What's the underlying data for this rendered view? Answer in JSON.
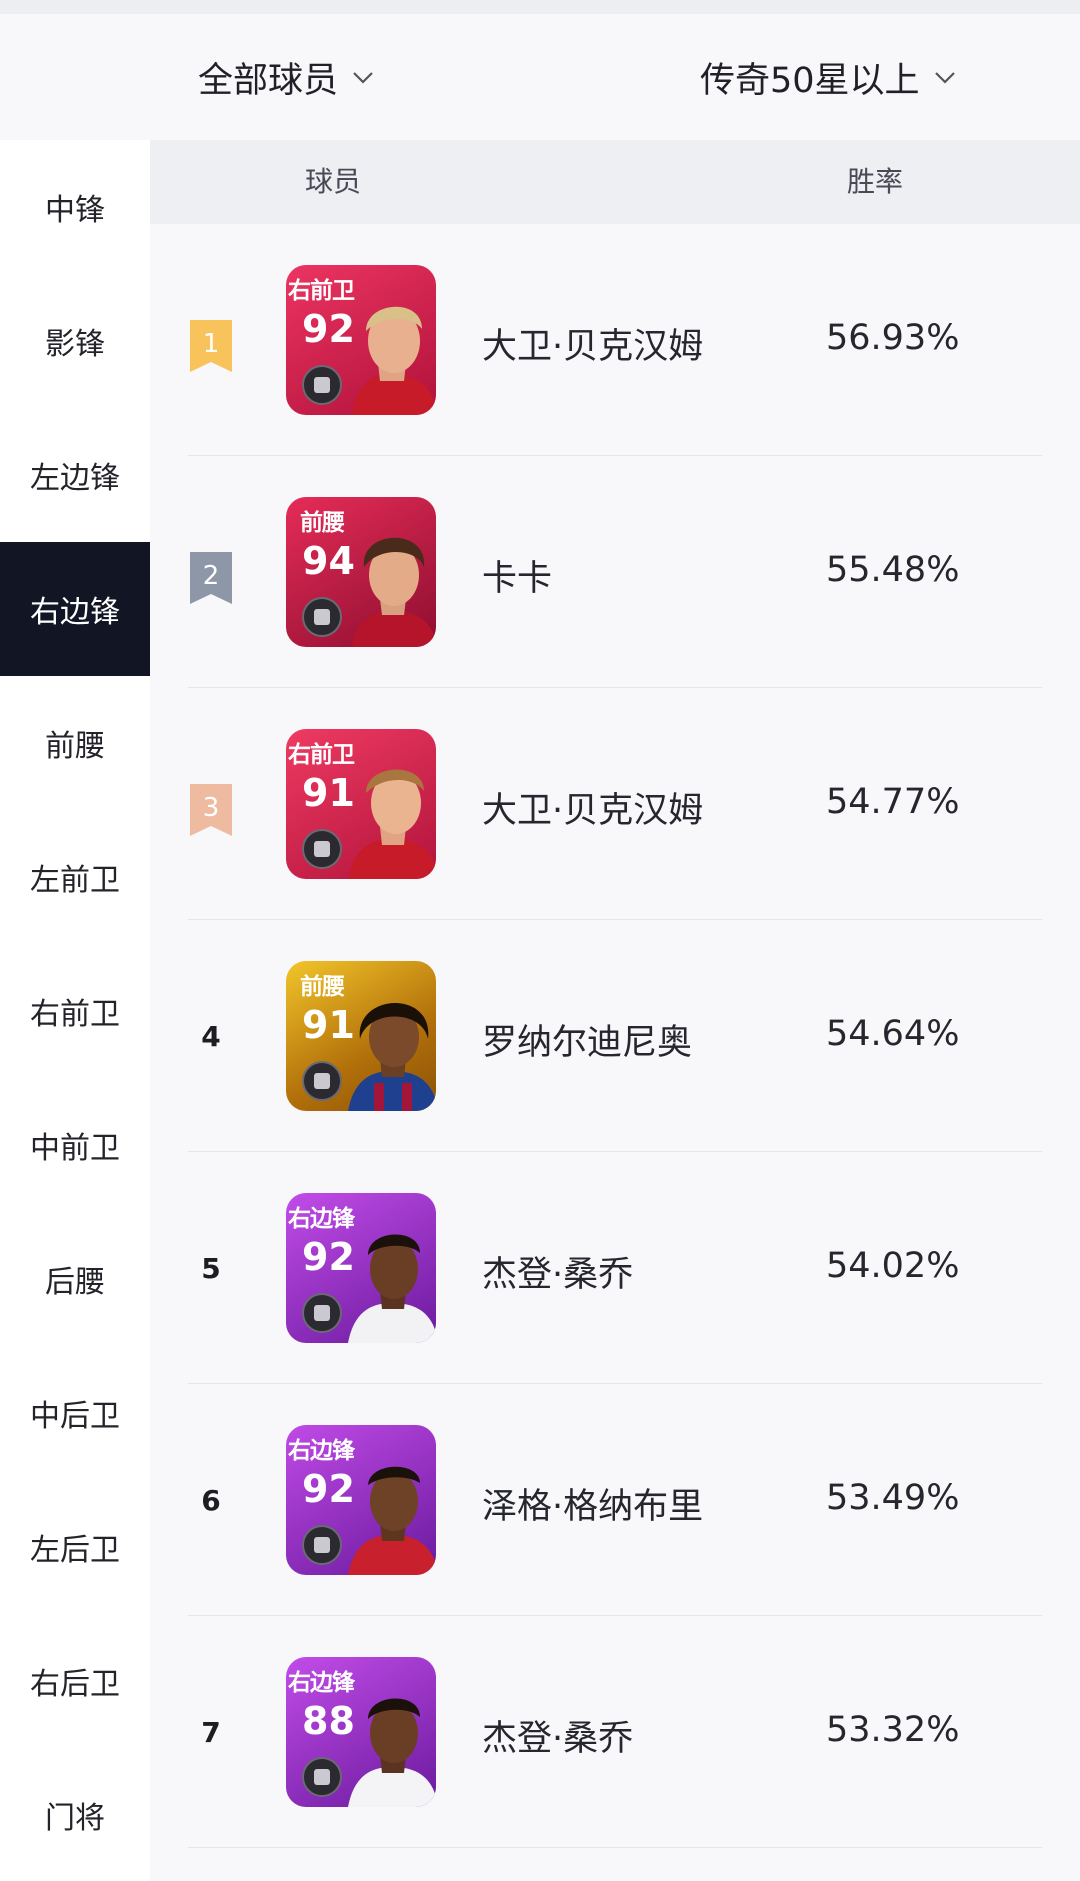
{
  "filters": {
    "player_filter": "全部球员",
    "rank_filter": "传奇50星以上"
  },
  "sidebar": {
    "items": [
      {
        "label": "中锋"
      },
      {
        "label": "影锋"
      },
      {
        "label": "左边锋"
      },
      {
        "label": "右边锋",
        "active": true
      },
      {
        "label": "前腰"
      },
      {
        "label": "左前卫"
      },
      {
        "label": "右前卫"
      },
      {
        "label": "中前卫"
      },
      {
        "label": "后腰"
      },
      {
        "label": "中后卫"
      },
      {
        "label": "左后卫"
      },
      {
        "label": "右后卫"
      },
      {
        "label": "门将"
      }
    ]
  },
  "table": {
    "header_player": "球员",
    "header_rate": "胜率",
    "rows": [
      {
        "rank": "1",
        "position": "右前卫",
        "rating": "92",
        "name": "大卫·贝克汉姆",
        "rate": "56.93%"
      },
      {
        "rank": "2",
        "position": "前腰",
        "rating": "94",
        "name": "卡卡",
        "rate": "55.48%"
      },
      {
        "rank": "3",
        "position": "右前卫",
        "rating": "91",
        "name": "大卫·贝克汉姆",
        "rate": "54.77%"
      },
      {
        "rank": "4",
        "position": "前腰",
        "rating": "91",
        "name": "罗纳尔迪尼奥",
        "rate": "54.64%"
      },
      {
        "rank": "5",
        "position": "右边锋",
        "rating": "92",
        "name": "杰登·桑乔",
        "rate": "54.02%"
      },
      {
        "rank": "6",
        "position": "右边锋",
        "rating": "92",
        "name": "泽格·格纳布里",
        "rate": "53.49%"
      },
      {
        "rank": "7",
        "position": "右边锋",
        "rating": "88",
        "name": "杰登·桑乔",
        "rate": "53.32%"
      }
    ]
  },
  "colors": {
    "sidebar_active_bg": "#121624",
    "rank1_flag": "#f7c35a",
    "rank2_flag": "#8e97a8",
    "rank3_flag": "#efbba0",
    "card_red": "#d8254e",
    "card_gold": "#c8860e",
    "card_purple": "#9a35c9"
  },
  "icons": {
    "dropdown": "chevron-down-icon",
    "rank_flag": "rank-ribbon-icon",
    "card_badge": "club-badge-icon"
  }
}
